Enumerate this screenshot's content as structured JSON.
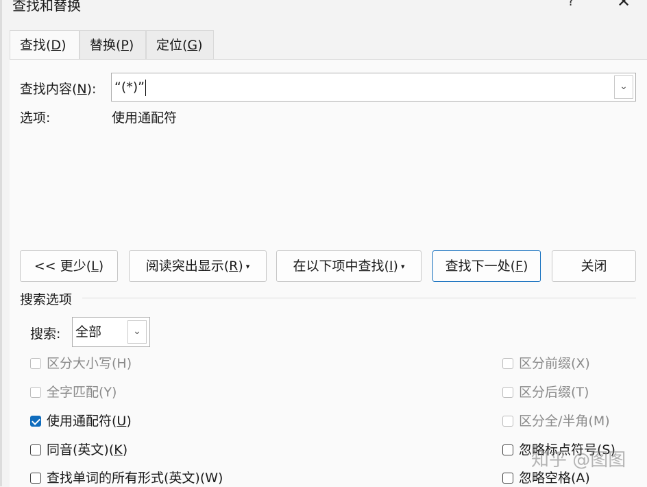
{
  "window": {
    "title": "查找和替换",
    "help_label": "?",
    "close_label": "✕"
  },
  "tabs": [
    {
      "text": "查找(",
      "key": "D",
      "suffix": ")",
      "active": true
    },
    {
      "text": "替换(",
      "key": "P",
      "suffix": ")",
      "active": false
    },
    {
      "text": "定位(",
      "key": "G",
      "suffix": ")",
      "active": false
    }
  ],
  "find": {
    "label_text": "查找内容(",
    "label_key": "N",
    "label_suffix": "):",
    "value": "“(*)”",
    "dropdown_icon": "chevron-down-icon"
  },
  "options": {
    "label": "选项:",
    "value": "使用通配符"
  },
  "buttons": {
    "less": {
      "text": "<< 更少(",
      "key": "L",
      "suffix": ")"
    },
    "reading_highlight": {
      "text": "阅读突出显示(",
      "key": "R",
      "suffix": ")",
      "arrow": "▾"
    },
    "find_in": {
      "text": "在以下项中查找(",
      "key": "I",
      "suffix": ")",
      "arrow": "▾"
    },
    "find_next": {
      "text": "查找下一处(",
      "key": "F",
      "suffix": ")"
    },
    "close": "关闭"
  },
  "search_options": {
    "title": "搜索选项",
    "search_label": "搜索:",
    "search_value": "全部"
  },
  "checkboxes_left": [
    {
      "label": "区分大小写(H)",
      "checked": false,
      "enabled": false
    },
    {
      "label": "全字匹配(Y)",
      "checked": false,
      "enabled": false
    },
    {
      "label_text": "使用通配符(",
      "label_key": "U",
      "label_suffix": ")",
      "checked": true,
      "enabled": true
    },
    {
      "label_text": "同音(英文)(",
      "label_key": "K",
      "label_suffix": ")",
      "checked": false,
      "enabled": true
    },
    {
      "label": "查找单词的所有形式(英文)(W)",
      "checked": false,
      "enabled": true
    }
  ],
  "checkboxes_right": [
    {
      "label": "区分前缀(X)",
      "checked": false,
      "enabled": false
    },
    {
      "label": "区分后缀(T)",
      "checked": false,
      "enabled": false
    },
    {
      "label": "区分全/半角(M)",
      "checked": false,
      "enabled": false
    },
    {
      "label": "忽略标点符号(S)",
      "checked": false,
      "enabled": true
    },
    {
      "label": "忽略空格(A)",
      "checked": false,
      "enabled": true
    }
  ],
  "watermark": "知乎 @图图",
  "colors": {
    "accent": "#0f6cbd",
    "disabled_text": "#8a8a8a"
  }
}
